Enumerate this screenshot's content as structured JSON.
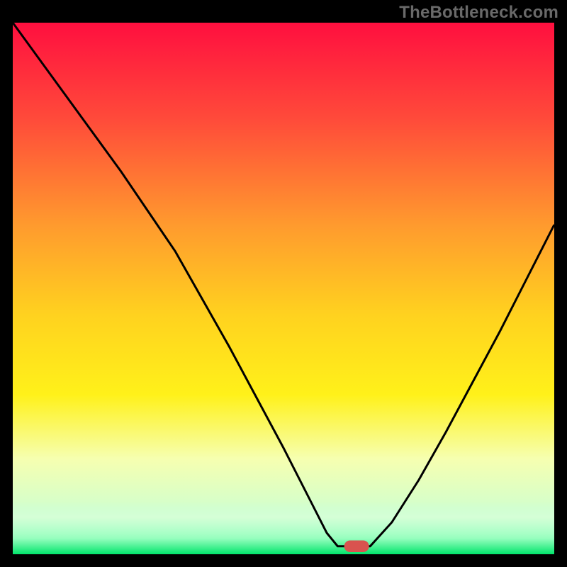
{
  "watermark": "TheBottleneck.com",
  "chart_data": {
    "type": "line",
    "title": "",
    "xlabel": "",
    "ylabel": "",
    "xlim": [
      0,
      100
    ],
    "ylim": [
      0,
      100
    ],
    "grid": false,
    "legend": false,
    "series": [
      {
        "name": "curve",
        "x": [
          0,
          5,
          10,
          15,
          20,
          25,
          30,
          35,
          40,
          45,
          50,
          55,
          58,
          60,
          62,
          66,
          70,
          75,
          80,
          85,
          90,
          95,
          100
        ],
        "y": [
          100,
          93,
          86,
          79,
          72,
          64.5,
          57,
          48,
          39,
          29.5,
          20,
          10,
          4,
          1.5,
          1.5,
          1.5,
          6,
          14,
          23,
          32.5,
          42,
          52,
          62
        ]
      }
    ],
    "marker": {
      "x": 63.5,
      "y": 1.5,
      "color": "#d9534f"
    },
    "baseline": {
      "y": 1.5,
      "color": "#00e56b",
      "fade_top": 10
    },
    "gradient_stops": [
      {
        "offset": 0,
        "color": "#ff0f3f"
      },
      {
        "offset": 18,
        "color": "#ff4a3a"
      },
      {
        "offset": 38,
        "color": "#ff9a2e"
      },
      {
        "offset": 55,
        "color": "#ffd21f"
      },
      {
        "offset": 70,
        "color": "#fff11a"
      },
      {
        "offset": 82,
        "color": "#f6ffb0"
      },
      {
        "offset": 90,
        "color": "#d8ffc8"
      },
      {
        "offset": 96,
        "color": "#7dffb0"
      },
      {
        "offset": 100,
        "color": "#00e56b"
      }
    ]
  }
}
